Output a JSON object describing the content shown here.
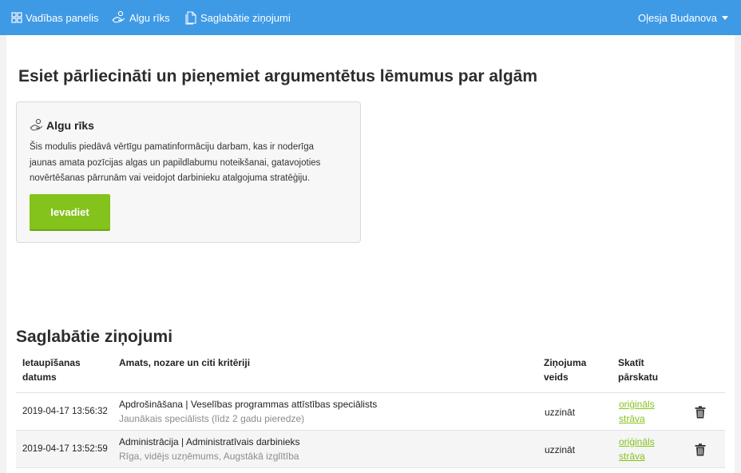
{
  "nav": {
    "dashboard_label": "Vadības panelis",
    "salary_tool_label": "Algu rīks",
    "saved_reports_label": "Saglabātie ziņojumi",
    "user_name": "Oļesja Budanova"
  },
  "hero": {
    "headline": "Esiet pārliecināti un pieņemiet argumentētus lēmumus par algām"
  },
  "card": {
    "title": "Algu rīks",
    "description_lines": [
      "Šis modulis piedāvā vērtīgu pamatinformāciju darbam, kas ir noderīga",
      "jaunas amata pozīcijas algas un papildlabumu noteikšanai, gatavojoties",
      "novērtēšanas pārrunām vai veidojot darbinieku atalgojuma stratēģiju."
    ],
    "button_label": "Ievadiet"
  },
  "saved_reports": {
    "title": "Saglabātie ziņojumi",
    "columns": {
      "date": [
        "Ietaupīšanas",
        "datums"
      ],
      "criteria": "Amats, nozare un citi kritēriji",
      "type": [
        "Ziņojuma",
        "veids"
      ],
      "view": [
        "Skatīt",
        "pārskatu"
      ]
    },
    "rows": [
      {
        "date": "2019-04-17 13:56:32",
        "criteria": "Apdrošināšana | Veselības programmas attīstības speciālists",
        "criteria_sub": "Jaunākais speciālists (līdz 2 gadu pieredze)",
        "type": "uzzināt",
        "link_original": "oriģināls",
        "link_current": "strāva"
      },
      {
        "date": "2019-04-17 13:52:59",
        "criteria": "Administrācija | Administratīvais darbinieks",
        "criteria_sub": "Rīga, vidējs uzņēmums, Augstākā izglītība",
        "type": "uzzināt",
        "link_original": "oriģināls",
        "link_current": "strāva"
      }
    ]
  },
  "colors": {
    "topbar": "#3f9ae6",
    "accent_green": "#84c21c"
  },
  "icons": {
    "dashboard": "grid-icon",
    "salary_tool": "hand-coins-icon",
    "saved_reports": "documents-icon",
    "user_menu": "caret-down-icon",
    "delete": "trash-icon"
  }
}
